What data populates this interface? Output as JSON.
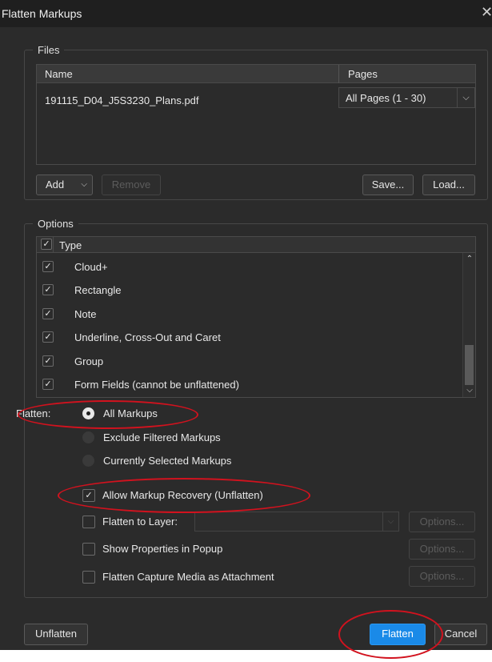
{
  "window": {
    "title": "Flatten Markups",
    "close_glyph": "✕"
  },
  "files": {
    "legend": "Files",
    "columns": {
      "name": "Name",
      "pages": "Pages"
    },
    "rows": [
      {
        "name": "191115_D04_J5S3230_Plans.pdf",
        "pages": "All Pages (1 - 30)"
      }
    ],
    "buttons": {
      "add": "Add",
      "remove": "Remove",
      "save": "Save...",
      "load": "Load..."
    }
  },
  "options": {
    "legend": "Options",
    "type_header": "Type",
    "types": [
      {
        "label": "Cloud+",
        "checked": true
      },
      {
        "label": "Rectangle",
        "checked": true
      },
      {
        "label": "Note",
        "checked": true
      },
      {
        "label": "Underline, Cross-Out and Caret",
        "checked": true
      },
      {
        "label": "Group",
        "checked": true
      },
      {
        "label": "Form Fields (cannot be unflattened)",
        "checked": true
      }
    ],
    "flatten_label": "Flatten:",
    "flatten_choices": [
      {
        "label": "All Markups",
        "selected": true
      },
      {
        "label": "Exclude Filtered Markups",
        "selected": false
      },
      {
        "label": "Currently Selected Markups",
        "selected": false
      }
    ],
    "checkboxes": [
      {
        "label": "Allow Markup Recovery (Unflatten)",
        "checked": true
      },
      {
        "label": "Flatten to Layer:",
        "checked": false
      },
      {
        "label": "Show Properties in Popup",
        "checked": false
      },
      {
        "label": "Flatten Capture Media as Attachment",
        "checked": false
      }
    ],
    "options_button": "Options..."
  },
  "footer": {
    "unflatten": "Unflatten",
    "flatten": "Flatten",
    "cancel": "Cancel"
  },
  "colors": {
    "dialog_bg": "#2b2b2b",
    "accent": "#1a8ae8",
    "annotation_red": "#d2121e"
  },
  "icons": {
    "check": "✓",
    "chevron_down": "⌵",
    "chevron_up": "⌃"
  }
}
